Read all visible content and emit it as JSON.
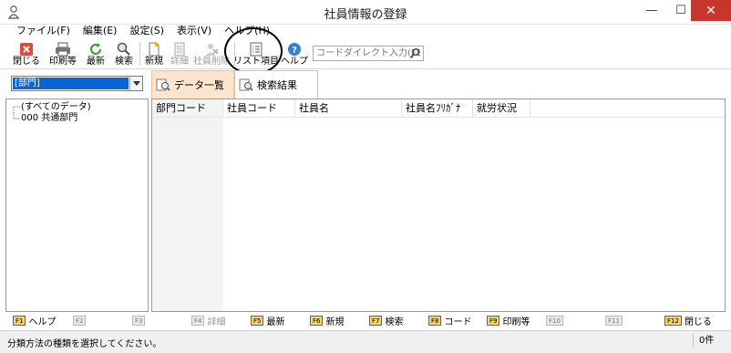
{
  "window": {
    "title": "社員情報の登録",
    "minimize": "—",
    "maximize": "☐",
    "close": "✕"
  },
  "menu": [
    "ファイル(F)",
    "編集(E)",
    "設定(S)",
    "表示(V)",
    "ヘルプ(H)"
  ],
  "toolbar": {
    "close": "閉じる",
    "print": "印刷等",
    "refresh": "最新",
    "search": "検索",
    "new": "新規",
    "detail": "詳細",
    "delete_employee": "社員削除",
    "list_items": "リスト項目",
    "help": "ヘルプ",
    "code_direct_placeholder": "コードダイレクト入力(F8)"
  },
  "classification_combo": {
    "value": "[部門]"
  },
  "tabs": {
    "data_list": "データ一覧",
    "search_results": "検索結果"
  },
  "tree": {
    "all_data": "(すべてのデータ)",
    "dept_000": "000 共通部門"
  },
  "grid": {
    "columns": [
      "部門コード",
      "社員コード",
      "社員名",
      "社員名ﾌﾘｶﾞﾅ",
      "就労状況"
    ]
  },
  "function_keys": [
    {
      "key": "F1",
      "label": "ヘルプ",
      "enabled": true
    },
    {
      "key": "F2",
      "label": "",
      "enabled": false
    },
    {
      "key": "F3",
      "label": "",
      "enabled": false
    },
    {
      "key": "F4",
      "label": "詳細",
      "enabled": false
    },
    {
      "key": "F5",
      "label": "最新",
      "enabled": true
    },
    {
      "key": "F6",
      "label": "新規",
      "enabled": true
    },
    {
      "key": "F7",
      "label": "検索",
      "enabled": true
    },
    {
      "key": "F8",
      "label": "コード",
      "enabled": true
    },
    {
      "key": "F9",
      "label": "印刷等",
      "enabled": true
    },
    {
      "key": "F10",
      "label": "",
      "enabled": false
    },
    {
      "key": "F11",
      "label": "",
      "enabled": false
    },
    {
      "key": "F12",
      "label": "閉じる",
      "enabled": true
    }
  ],
  "status": {
    "message": "分類方法の種類を選択してください。",
    "count": "0件"
  },
  "colors": {
    "close_button": "#c7362c",
    "active_tab": "#fce4cd",
    "combo_selected": "#0a64d2",
    "fkey_badge": "#f5d36a"
  }
}
